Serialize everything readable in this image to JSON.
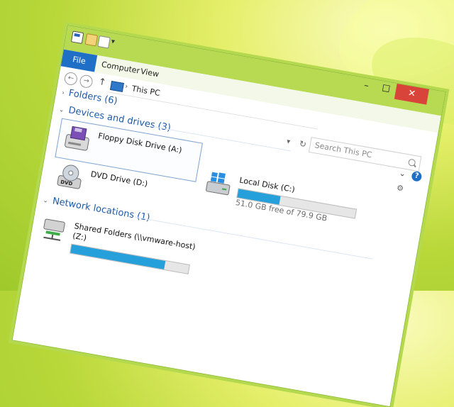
{
  "window": {
    "title": "This PC",
    "controls": {
      "minimize": "–",
      "maximize": "☐",
      "close": "✕"
    }
  },
  "ribbon": {
    "tabs": [
      "File",
      "Computer",
      "View"
    ]
  },
  "address_bar": {
    "crumb": "This PC",
    "search_placeholder": "Search This PC"
  },
  "groups": {
    "folders": "Folders (6)",
    "devices": "Devices and drives (3)",
    "network": "Network locations (1)"
  },
  "drives": {
    "floppy": {
      "name": "Floppy Disk Drive (A:)"
    },
    "dvd": {
      "name": "DVD Drive (D:)"
    },
    "local": {
      "name": "Local Disk (C:)",
      "free_text": "51.0 GB free of 79.9 GB",
      "used_fraction": 0.36
    },
    "shared": {
      "name": "Shared Folders (\\\\vmware-host)",
      "sub": "(Z:)",
      "used_fraction": 0.8
    }
  },
  "colors": {
    "accent": "#1f6fc6",
    "titlebar": "#b8da53",
    "close_button": "#d9443a",
    "usage_bar": "#26a0da"
  }
}
